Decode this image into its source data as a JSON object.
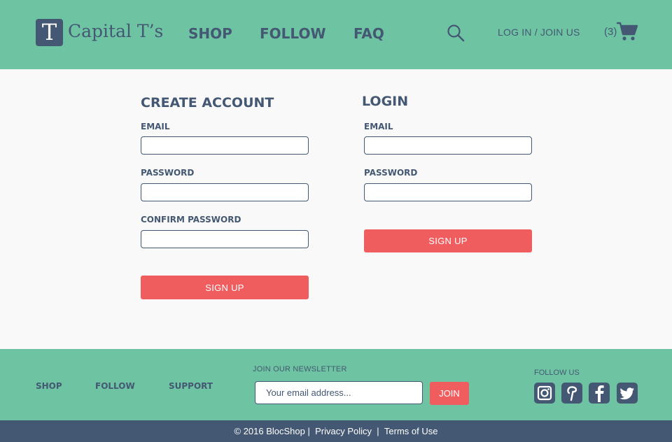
{
  "header": {
    "logo_letter": "T",
    "brand": "Capital T’s",
    "nav": [
      "SHOP",
      "FOLLOW",
      "FAQ"
    ],
    "login_link": "LOG IN / JOIN US",
    "cart_count": "(3)",
    "icons": [
      "search-icon",
      "cart-icon"
    ]
  },
  "create_account": {
    "title": "CREATE ACCOUNT",
    "email_label": "EMAIL",
    "password_label": "PASSWORD",
    "confirm_label": "CONFIRM PASSWORD",
    "button": "SIGN UP"
  },
  "login": {
    "title": "LOGIN",
    "email_label": "EMAIL",
    "password_label": "PASSWORD",
    "button": "SIGN UP"
  },
  "footer": {
    "links": [
      "SHOP",
      "FOLLOW",
      "SUPPORT"
    ],
    "newsletter_label": "JOIN OUR NEWSLETTER",
    "newsletter_placeholder": "Your email address...",
    "join_button": "JOIN",
    "follow_label": "FOLLOW US",
    "social_icons": [
      "instagram-icon",
      "pinterest-icon",
      "facebook-icon",
      "twitter-icon"
    ]
  },
  "bottom": {
    "copyright": "© 2016 BlocShop",
    "sep1": "|",
    "privacy": "Privacy Policy",
    "sep2": "|",
    "terms": "Terms of Use"
  },
  "colors": {
    "accent_green": "#6ec4a2",
    "navy": "#445873",
    "button_red": "#ef5d5f",
    "background": "#f9f9f9"
  }
}
